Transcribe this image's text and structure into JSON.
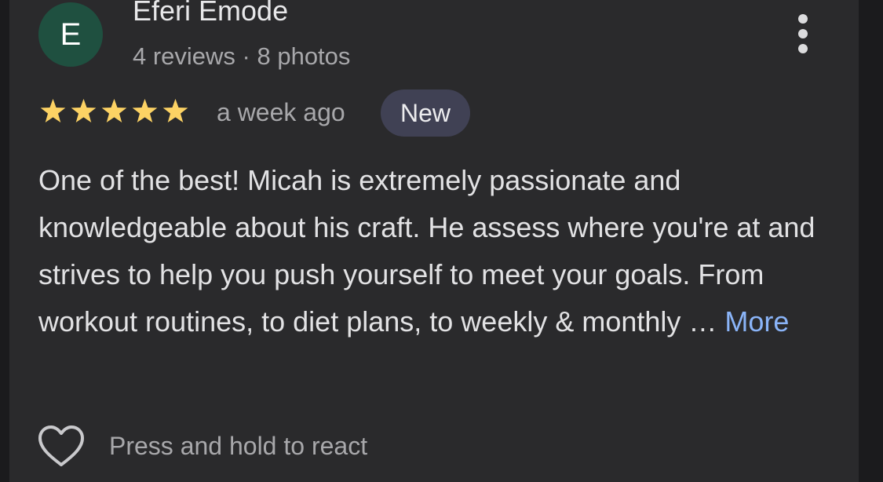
{
  "author": {
    "initial": "E",
    "name": "Eferi Emode",
    "meta": "4 reviews · 8 photos",
    "avatar_color": "#1f5040"
  },
  "review": {
    "rating": 5,
    "max_rating": 5,
    "star_color": "#fcd264",
    "time": "a week ago",
    "badge": "New",
    "text": "One of the best! Micah is extremely passionate and knowledgeable about his craft. He assess where you're at and strives to help you push yourself to meet your goals. From workout routines, to diet plans, to weekly & monthly … ",
    "more_label": "More",
    "link_color": "#8ab4f8"
  },
  "actions": {
    "overflow_icon": "more-vert-icon",
    "react_icon": "heart-icon",
    "react_hint": "Press and hold to react"
  }
}
